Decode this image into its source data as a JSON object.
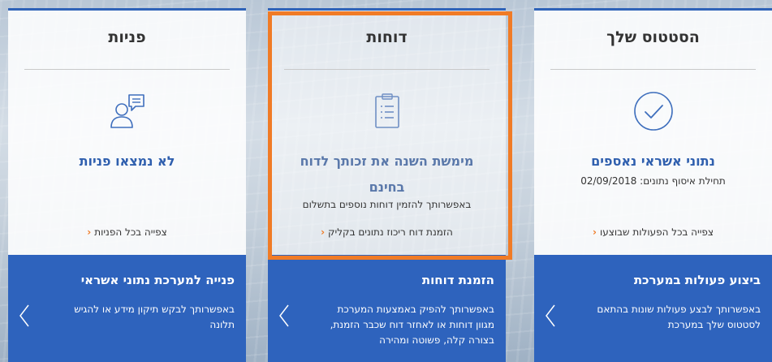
{
  "cards": {
    "status": {
      "title": "הסטטוס שלך",
      "headline": "נתוני אשראי נאספים",
      "subtext": "תחילת איסוף נתונים: 02/09/2018",
      "link": "צפייה בכל הפעולות שבוצעו",
      "icon": "check-circle-icon",
      "bottom_title": "ביצוע פעולות במערכת",
      "bottom_text": "באפשרותך לבצע פעולות שונות בהתאם לסטטוס שלך במערכת"
    },
    "reports": {
      "title": "דוחות",
      "headline": "מימשת השנה את זכותך לדוח בחינם",
      "subtext": "באפשרותך להזמין דוחות נוספים בתשלום",
      "link": "הזמנת דוח ריכוז נתונים בקליק",
      "icon": "clipboard-list-icon",
      "bottom_title": "הזמנת דוחות",
      "bottom_text": "באפשרותך להפיק באמצעות המערכת מגוון דוחות או לאחזר דוח שכבר הזמנת, בצורה קלה, פשוטה ומהירה"
    },
    "inquiries": {
      "title": "פניות",
      "headline": "לא נמצאו פניות",
      "link": "צפייה בכל הפניות",
      "icon": "user-message-icon",
      "bottom_title": "פנייה למערכת נתוני אשראי",
      "bottom_text": "באפשרותך לבקש תיקון מידע או להגיש תלונה"
    }
  },
  "colors": {
    "brand_blue": "#2e63bd",
    "link_chevron": "#f07b26",
    "highlight": "#f07b26",
    "icon_stroke": "#3f6fbd"
  }
}
